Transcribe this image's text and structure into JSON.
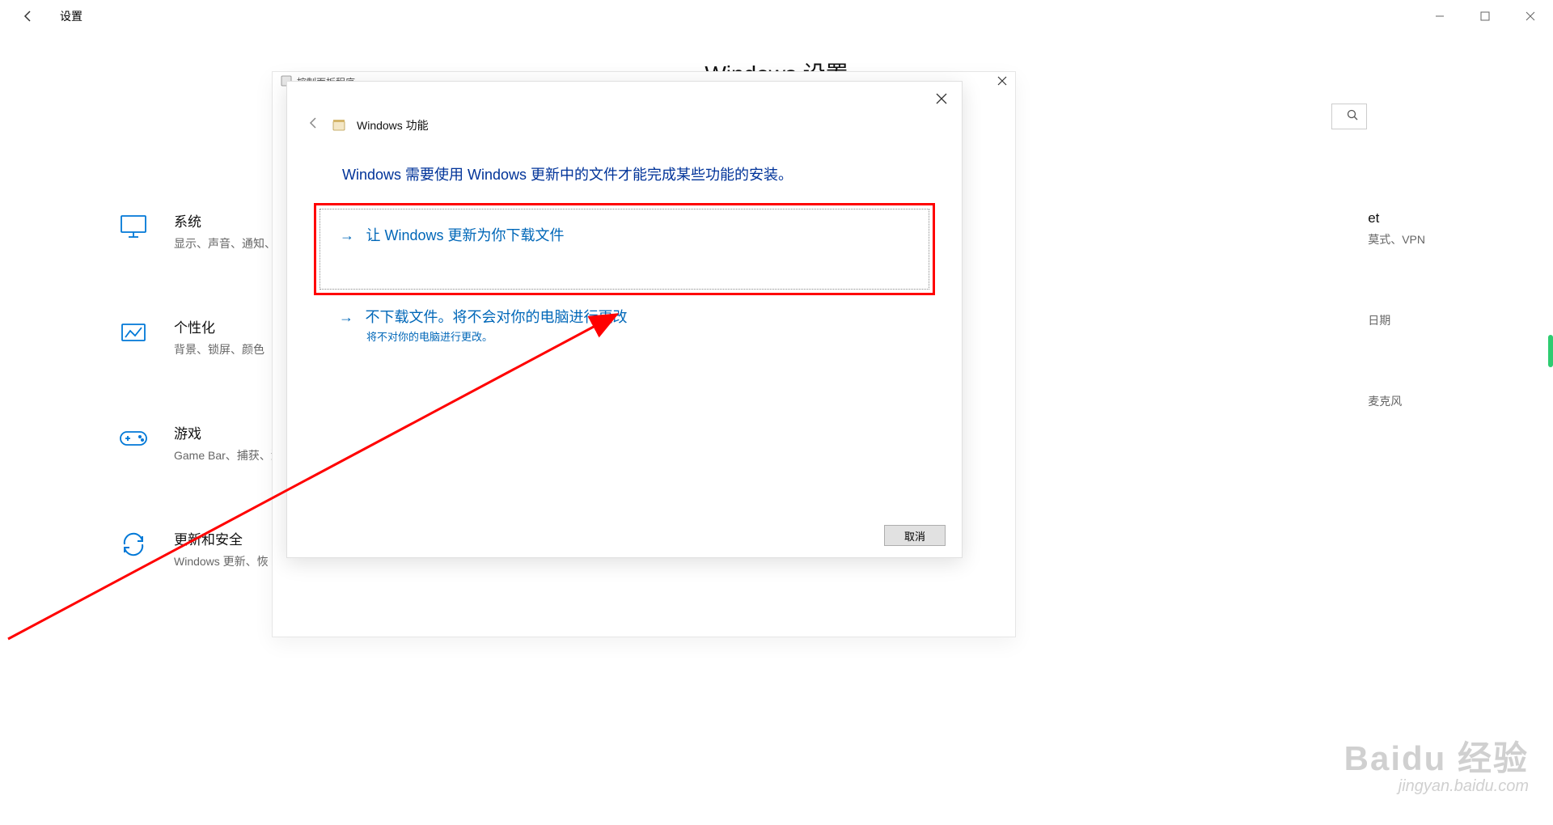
{
  "titlebar": {
    "title": "设置"
  },
  "settings_header": "Windows 设置",
  "tiles": {
    "left": [
      {
        "title": "系统",
        "subtitle": "显示、声音、通知、"
      },
      {
        "title": "个性化",
        "subtitle": "背景、锁屏、颜色"
      },
      {
        "title": "游戏",
        "subtitle": "Game Bar、捕获、游"
      },
      {
        "title": "更新和安全",
        "subtitle": "Windows 更新、恢"
      }
    ],
    "right": [
      {
        "title": "et",
        "subtitle": "莫式、VPN"
      },
      {
        "title": "",
        "subtitle": "日期"
      },
      {
        "title": "",
        "subtitle": "麦克风"
      }
    ]
  },
  "control_panel": {
    "title": "控制面板程序"
  },
  "wf_dialog": {
    "title": "Windows 功能",
    "message": "Windows 需要使用 Windows 更新中的文件才能完成某些功能的安装。",
    "action1": "让 Windows 更新为你下载文件",
    "action2": "不下载文件。将不会对你的电脑进行更改",
    "action2_sub": "将不对你的电脑进行更改。",
    "cancel_btn": "取消"
  },
  "watermark": {
    "line1": "Baidu 经验",
    "line2": "jingyan.baidu.com"
  }
}
